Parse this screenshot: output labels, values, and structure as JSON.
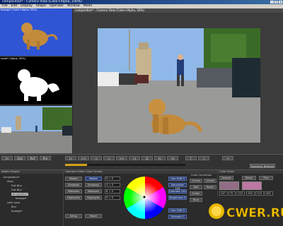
{
  "window": {
    "title": "composition* - Camera View (Color+Alpha, 100%)",
    "buttons": [
      "_",
      "□",
      "x"
    ]
  },
  "menu": [
    "File",
    "Edit",
    "Display",
    "Shape",
    "Operator",
    "Window",
    "Mode"
  ],
  "thumbnails": [
    {
      "label": "footage* (Color+Alpha, 50%)"
    },
    {
      "label": "mask* (Alpha, 50%)"
    },
    {
      "label": ""
    }
  ],
  "viewer": {
    "title": "composition* - Camera View (Color+Alpha, 50%)"
  },
  "transport": {
    "buttons": [
      "|<",
      "<<",
      "<",
      ">",
      ">>",
      ">|",
      "O",
      "I<",
      ">I",
      "[",
      "]",
      "+"
    ],
    "left_buttons": [
      "In",
      "Out",
      "Ref",
      "Pro"
    ],
    "progress": 0.18,
    "dynamic_label": "Dynamic Refresh"
  },
  "tree": {
    "header": "Nodes  Shapes",
    "rows": [
      "composition*",
      "Mask",
      "Flat Blur",
      "Flat Blur",
      "composition*",
      "footage*",
      "color pass",
      "Blur",
      "footage*"
    ]
  },
  "ops": {
    "header": "Operator  Editor  Color Correct",
    "left_buttons": [
      "Master",
      "Shadows",
      "Midtones",
      "Highlights",
      "Setup"
    ],
    "mid_buttons": [
      "Master",
      "Shadows",
      "Midtones",
      "Highlights",
      "Reset"
    ],
    "fields": [
      "R = 0",
      "G = 0",
      "B = 0",
      "R = 0"
    ],
    "right_labels": [
      "Hue Shift 0",
      "Saturation 100",
      "Contrast 100",
      "Brightness 0"
    ],
    "lower_labels": [
      "Hue Shift 0",
      "Strength 0"
    ]
  },
  "correction": {
    "header": "Color Correction",
    "buttons": [
      "Curves",
      "Levels",
      "Reset"
    ],
    "rows": [
      "Red",
      "Green",
      "Blue"
    ]
  },
  "picker": {
    "header": "Color Picker",
    "buttons": [
      "Sample",
      "Reset",
      "Pick"
    ],
    "values": [
      "147",
      "75",
      "133",
      "190",
      "119",
      "162"
    ]
  },
  "logo_text": "CWER.RU",
  "colors": {
    "accent": "#d4a017",
    "hilite": "#2d3f70",
    "bg": "#2a2a2a"
  }
}
